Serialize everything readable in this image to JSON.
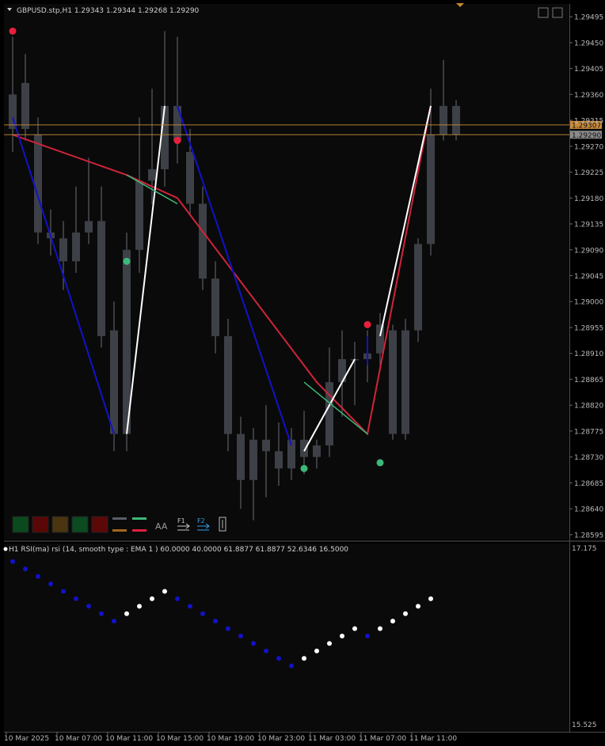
{
  "header": {
    "symbol_line": "GBPUSD.stp,H1  1.29343 1.29344 1.29268 1.29290"
  },
  "indicator": {
    "label": "H1 RSI(ma) rsi (14, smooth type : EMA  1 ) 60.0000 40.0000 61.8877 61.8877 52.6346 16.5000",
    "axis_top": "17.175",
    "axis_bottom": "15.525"
  },
  "price_badges": [
    "1.29307",
    "1.29290"
  ],
  "toolbar": {
    "font_label": "AA",
    "f1_label": "F1",
    "f2_label": "F2",
    "swatches": [
      "#0b4a1e",
      "#5a0707",
      "#4a3510",
      "#0c4a20",
      "#5c0808"
    ]
  },
  "colors": {
    "background": "#0a0a0a",
    "candle": "#3d4046",
    "wick": "#6b6f76",
    "zigzag_red": "#d0243a",
    "zigzag_blue": "#1212c8",
    "zigzag_white": "#ffffff",
    "zigzag_green": "#3cb878",
    "signal_red": "#e8203c",
    "signal_green": "#3cb87a",
    "price_line": "#c88a3a"
  },
  "chart_data": {
    "type": "candlestick",
    "y_ticks": [
      "1.29495",
      "1.29450",
      "1.29405",
      "1.29360",
      "1.29315",
      "1.29270",
      "1.29225",
      "1.29180",
      "1.29135",
      "1.29090",
      "1.29045",
      "1.29000",
      "1.28955",
      "1.28910",
      "1.28865",
      "1.28820",
      "1.28775",
      "1.28730",
      "1.28685",
      "1.28640",
      "1.28595"
    ],
    "ylim": [
      1.2859,
      1.295
    ],
    "x_labels": [
      "10 Mar 2025",
      "10 Mar 07:00",
      "10 Mar 11:00",
      "10 Mar 15:00",
      "10 Mar 19:00",
      "10 Mar 23:00",
      "11 Mar 03:00",
      "11 Mar 07:00",
      "11 Mar 11:00"
    ],
    "candles": [
      {
        "o": 1.293,
        "h": 1.2946,
        "l": 1.2926,
        "c": 1.2936
      },
      {
        "o": 1.2938,
        "h": 1.2943,
        "l": 1.2928,
        "c": 1.293
      },
      {
        "o": 1.2929,
        "h": 1.2932,
        "l": 1.291,
        "c": 1.2912
      },
      {
        "o": 1.2912,
        "h": 1.2916,
        "l": 1.2908,
        "c": 1.2911
      },
      {
        "o": 1.2911,
        "h": 1.2914,
        "l": 1.2902,
        "c": 1.2907
      },
      {
        "o": 1.2907,
        "h": 1.292,
        "l": 1.2905,
        "c": 1.2912
      },
      {
        "o": 1.2912,
        "h": 1.2925,
        "l": 1.291,
        "c": 1.2914
      },
      {
        "o": 1.2914,
        "h": 1.292,
        "l": 1.2892,
        "c": 1.2894
      },
      {
        "o": 1.2895,
        "h": 1.29,
        "l": 1.2874,
        "c": 1.2877
      },
      {
        "o": 1.2877,
        "h": 1.2912,
        "l": 1.2874,
        "c": 1.2909
      },
      {
        "o": 1.2909,
        "h": 1.2932,
        "l": 1.2905,
        "c": 1.2921
      },
      {
        "o": 1.2921,
        "h": 1.2937,
        "l": 1.2917,
        "c": 1.2923
      },
      {
        "o": 1.2923,
        "h": 1.2947,
        "l": 1.292,
        "c": 1.2934
      },
      {
        "o": 1.2934,
        "h": 1.2946,
        "l": 1.2924,
        "c": 1.2928
      },
      {
        "o": 1.2926,
        "h": 1.293,
        "l": 1.2915,
        "c": 1.2917
      },
      {
        "o": 1.2917,
        "h": 1.292,
        "l": 1.2902,
        "c": 1.2904
      },
      {
        "o": 1.2904,
        "h": 1.2907,
        "l": 1.2891,
        "c": 1.2894
      },
      {
        "o": 1.2894,
        "h": 1.2897,
        "l": 1.2874,
        "c": 1.2877
      },
      {
        "o": 1.2877,
        "h": 1.288,
        "l": 1.2864,
        "c": 1.2869
      },
      {
        "o": 1.2869,
        "h": 1.2878,
        "l": 1.2862,
        "c": 1.2876
      },
      {
        "o": 1.2876,
        "h": 1.2882,
        "l": 1.2866,
        "c": 1.2874
      },
      {
        "o": 1.2874,
        "h": 1.2879,
        "l": 1.2868,
        "c": 1.2871
      },
      {
        "o": 1.2871,
        "h": 1.2878,
        "l": 1.2869,
        "c": 1.2876
      },
      {
        "o": 1.2876,
        "h": 1.2881,
        "l": 1.287,
        "c": 1.2873
      },
      {
        "o": 1.2873,
        "h": 1.2876,
        "l": 1.2871,
        "c": 1.2875
      },
      {
        "o": 1.2875,
        "h": 1.2892,
        "l": 1.2873,
        "c": 1.2886
      },
      {
        "o": 1.2886,
        "h": 1.2895,
        "l": 1.288,
        "c": 1.289
      },
      {
        "o": 1.289,
        "h": 1.2893,
        "l": 1.2882,
        "c": 1.289
      },
      {
        "o": 1.289,
        "h": 1.2895,
        "l": 1.2886,
        "c": 1.2891
      },
      {
        "o": 1.2891,
        "h": 1.2898,
        "l": 1.2888,
        "c": 1.2896
      },
      {
        "o": 1.2895,
        "h": 1.2896,
        "l": 1.2876,
        "c": 1.2877
      },
      {
        "o": 1.2877,
        "h": 1.2897,
        "l": 1.2876,
        "c": 1.2895
      },
      {
        "o": 1.2895,
        "h": 1.2911,
        "l": 1.2893,
        "c": 1.291
      },
      {
        "o": 1.291,
        "h": 1.2937,
        "l": 1.2908,
        "c": 1.2929
      },
      {
        "o": 1.2929,
        "h": 1.2942,
        "l": 1.2928,
        "c": 1.2934
      },
      {
        "o": 1.2934,
        "h": 1.2935,
        "l": 1.2928,
        "c": 1.2929
      }
    ],
    "zigzags": [
      {
        "color": "red",
        "points": [
          [
            0.5,
            1.2929
          ],
          [
            9.5,
            1.2922
          ],
          [
            13.5,
            1.2918
          ],
          [
            24.5,
            1.2886
          ],
          [
            28.5,
            1.2877
          ],
          [
            33.5,
            1.2934
          ]
        ]
      },
      {
        "color": "blue",
        "points": [
          [
            0.5,
            1.2932
          ],
          [
            8.5,
            1.2877
          ]
        ]
      },
      {
        "color": "blue",
        "points": [
          [
            13.5,
            1.2934
          ],
          [
            22.5,
            1.2875
          ]
        ]
      },
      {
        "color": "white",
        "points": [
          [
            9.5,
            1.2877
          ],
          [
            12.5,
            1.2934
          ]
        ]
      },
      {
        "color": "white",
        "points": [
          [
            23.5,
            1.2874
          ],
          [
            27.5,
            1.289
          ]
        ]
      },
      {
        "color": "white",
        "points": [
          [
            29.5,
            1.2894
          ],
          [
            33.5,
            1.2934
          ]
        ]
      },
      {
        "color": "blue",
        "points": [
          [
            28.5,
            1.2894
          ],
          [
            28.5,
            1.2889
          ]
        ]
      },
      {
        "color": "green",
        "points": [
          [
            9.5,
            1.2922
          ],
          [
            13.5,
            1.2917
          ]
        ]
      },
      {
        "color": "green",
        "points": [
          [
            23.5,
            1.2886
          ],
          [
            28.5,
            1.2877
          ]
        ]
      }
    ],
    "signals": [
      {
        "i": 0.5,
        "p": 1.2947,
        "color": "red"
      },
      {
        "i": 13.5,
        "p": 1.2928,
        "color": "red"
      },
      {
        "i": 28.5,
        "p": 1.2896,
        "color": "red"
      },
      {
        "i": 9.5,
        "p": 1.2907,
        "color": "green"
      },
      {
        "i": 23.5,
        "p": 1.2871,
        "color": "green"
      },
      {
        "i": 29.5,
        "p": 1.2872,
        "color": "green"
      }
    ],
    "price_levels": [
      1.29307,
      1.2929
    ],
    "rsi": {
      "ylim": [
        15.525,
        17.175
      ],
      "dots": [
        {
          "i": 0.5,
          "v": 17.05,
          "c": "blue"
        },
        {
          "i": 1.5,
          "v": 16.98,
          "c": "blue"
        },
        {
          "i": 2.5,
          "v": 16.91,
          "c": "blue"
        },
        {
          "i": 3.5,
          "v": 16.84,
          "c": "blue"
        },
        {
          "i": 4.5,
          "v": 16.77,
          "c": "blue"
        },
        {
          "i": 5.5,
          "v": 16.7,
          "c": "blue"
        },
        {
          "i": 6.5,
          "v": 16.63,
          "c": "blue"
        },
        {
          "i": 7.5,
          "v": 16.56,
          "c": "blue"
        },
        {
          "i": 8.5,
          "v": 16.49,
          "c": "blue"
        },
        {
          "i": 9.5,
          "v": 16.56,
          "c": "white"
        },
        {
          "i": 10.5,
          "v": 16.63,
          "c": "white"
        },
        {
          "i": 11.5,
          "v": 16.7,
          "c": "white"
        },
        {
          "i": 12.5,
          "v": 16.77,
          "c": "white"
        },
        {
          "i": 13.5,
          "v": 16.7,
          "c": "blue"
        },
        {
          "i": 14.5,
          "v": 16.63,
          "c": "blue"
        },
        {
          "i": 15.5,
          "v": 16.56,
          "c": "blue"
        },
        {
          "i": 16.5,
          "v": 16.49,
          "c": "blue"
        },
        {
          "i": 17.5,
          "v": 16.42,
          "c": "blue"
        },
        {
          "i": 18.5,
          "v": 16.35,
          "c": "blue"
        },
        {
          "i": 19.5,
          "v": 16.28,
          "c": "blue"
        },
        {
          "i": 20.5,
          "v": 16.21,
          "c": "blue"
        },
        {
          "i": 21.5,
          "v": 16.14,
          "c": "blue"
        },
        {
          "i": 22.5,
          "v": 16.07,
          "c": "blue"
        },
        {
          "i": 23.5,
          "v": 16.14,
          "c": "white"
        },
        {
          "i": 24.5,
          "v": 16.21,
          "c": "white"
        },
        {
          "i": 25.5,
          "v": 16.28,
          "c": "white"
        },
        {
          "i": 26.5,
          "v": 16.35,
          "c": "white"
        },
        {
          "i": 27.5,
          "v": 16.42,
          "c": "white"
        },
        {
          "i": 28.5,
          "v": 16.35,
          "c": "blue"
        },
        {
          "i": 29.5,
          "v": 16.42,
          "c": "white"
        },
        {
          "i": 30.5,
          "v": 16.49,
          "c": "white"
        },
        {
          "i": 31.5,
          "v": 16.56,
          "c": "white"
        },
        {
          "i": 32.5,
          "v": 16.63,
          "c": "white"
        },
        {
          "i": 33.5,
          "v": 16.7,
          "c": "white"
        }
      ]
    }
  }
}
